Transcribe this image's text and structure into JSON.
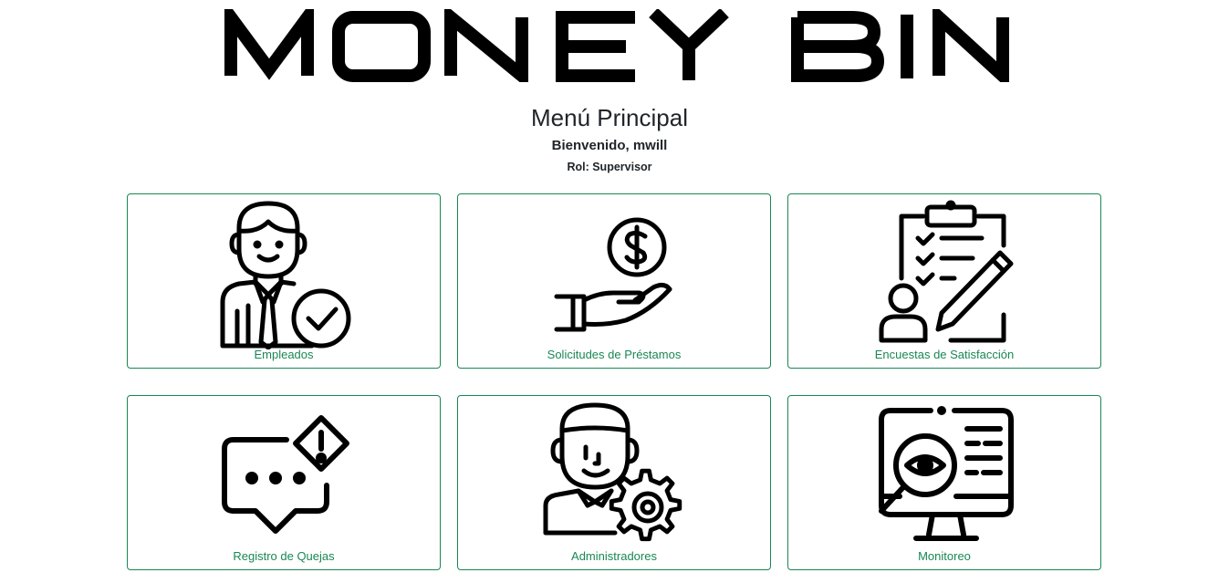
{
  "header": {
    "logo_text": "MONEY BIN",
    "title": "Menú Principal",
    "welcome": "Bienvenido, mwill",
    "role": "Rol: Supervisor"
  },
  "theme": {
    "accent": "#198754",
    "icon_color": "#000000"
  },
  "menu": [
    {
      "label": "Empleados",
      "icon": "employee-check-icon"
    },
    {
      "label": "Solicitudes de Préstamos",
      "icon": "hand-dollar-icon"
    },
    {
      "label": "Encuestas de Satisfacción",
      "icon": "survey-clipboard-icon"
    },
    {
      "label": "Registro de Quejas",
      "icon": "complaint-chat-icon"
    },
    {
      "label": "Administradores",
      "icon": "admin-gear-icon"
    },
    {
      "label": "Monitoreo",
      "icon": "monitor-eye-icon"
    }
  ]
}
